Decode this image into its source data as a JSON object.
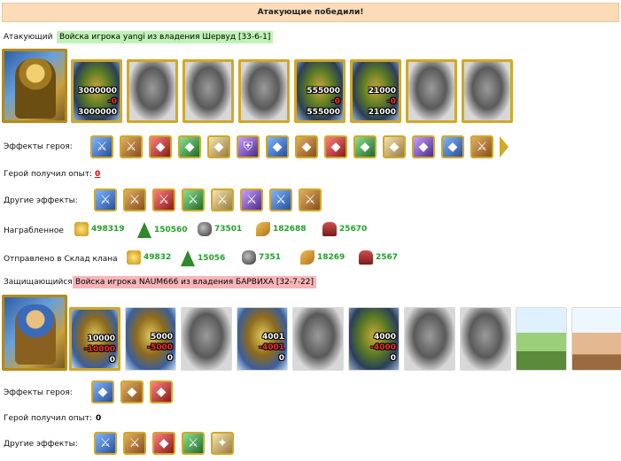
{
  "banner": "Атакующие победили!",
  "attacker": {
    "label": "Атакующий",
    "army_tag": "Войска игрока yangi из владения Шервуд [33-6-1]",
    "units": [
      {
        "icon": "golden-archer-unit",
        "style": "color",
        "top": "3000000",
        "loss": "-0",
        "bottom": "3000000"
      },
      {
        "icon": "gray-warrior-unit",
        "style": "gray"
      },
      {
        "icon": "gray-knight-unit",
        "style": "gray"
      },
      {
        "icon": "gray-griffin-unit",
        "style": "gray"
      },
      {
        "icon": "crossbowman-unit",
        "style": "color",
        "top": "555000",
        "loss": "-0",
        "bottom": "555000"
      },
      {
        "icon": "green-guard-unit",
        "style": "color",
        "top": "21000",
        "loss": "-0",
        "bottom": "21000"
      },
      {
        "icon": "gray-dark-knight-unit",
        "style": "gray"
      },
      {
        "icon": "gray-reaper-unit",
        "style": "gray"
      }
    ],
    "effects_label": "Эффекты героя:",
    "effects": [
      "sword-icon",
      "shield-sword-icon",
      "glove-icon",
      "chest-icon",
      "potion-icon",
      "shield-icon",
      "banner-icon",
      "bag-icon",
      "ring-icon",
      "book-icon",
      "scroll-icon",
      "crystal-icon",
      "tent-icon",
      "spear-icon"
    ],
    "xp_label": "Герой получил опыт:",
    "xp_value": "0",
    "other_label": "Другие эффекты:",
    "other_effects": [
      "blue-sword-icon",
      "sword-icon",
      "red-sword-icon",
      "blue-sword-icon",
      "red-sword-icon",
      "red-sword-icon",
      "sword-icon",
      "red-sword-icon"
    ],
    "loot_label": "Награбленное",
    "loot": [
      {
        "res": "gold",
        "value": "498319"
      },
      {
        "res": "wood",
        "value": "150560"
      },
      {
        "res": "ore",
        "value": "73501"
      },
      {
        "res": "wheat",
        "value": "182688"
      },
      {
        "res": "stone",
        "value": "25670"
      }
    ],
    "clan_label": "Отправлено в Склад клана",
    "clan": [
      {
        "res": "gold",
        "value": "49832"
      },
      {
        "res": "wood",
        "value": "15056"
      },
      {
        "res": "ore",
        "value": "7351"
      },
      {
        "res": "wheat",
        "value": "18269"
      },
      {
        "res": "stone",
        "value": "2567"
      }
    ]
  },
  "defender": {
    "label": "Защищающийся",
    "army_tag": "Войска игрока NAUM666 из владения БАРВИХА [32-7-22]",
    "units": [
      {
        "icon": "peasant-cart-unit",
        "style": "colorb",
        "top": "10000",
        "loss": "-10000",
        "bottom": "0",
        "framed": true
      },
      {
        "icon": "golden-spearman-unit",
        "style": "colorb",
        "top": "5000",
        "loss": "-5000",
        "bottom": "0"
      },
      {
        "icon": "gray-knight-unit",
        "style": "gray"
      },
      {
        "icon": "griffin-unit",
        "style": "colorb",
        "top": "4001",
        "loss": "-4001",
        "bottom": "0"
      },
      {
        "icon": "gray-archer-unit",
        "style": "gray"
      },
      {
        "icon": "green-guard-unit",
        "style": "color",
        "top": "4000",
        "loss": "-4000",
        "bottom": "0"
      },
      {
        "icon": "gray-dark-knight-unit",
        "style": "gray"
      },
      {
        "icon": "gray-reaper-unit",
        "style": "gray"
      },
      {
        "icon": "green-tower-unit",
        "style": "tower"
      },
      {
        "icon": "stone-tower-unit",
        "style": "tower2"
      }
    ],
    "effects_label": "Эффекты героя:",
    "effects": [
      "cart-icon",
      "wall-icon",
      "eye-icon"
    ],
    "xp_label": "Герой получил опыт:",
    "xp_value": "0",
    "other_label": "Другие эффекты:",
    "other_effects": [
      "heart-sword-icon",
      "heart-sword-icon",
      "potion-bottle-icon",
      "blue-sword-icon",
      "dove-icon"
    ]
  }
}
